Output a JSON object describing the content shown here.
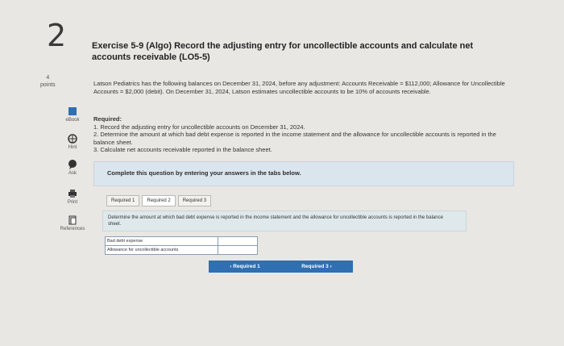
{
  "question": {
    "number": "2",
    "points_value": "4",
    "points_label": "points"
  },
  "sidebar": {
    "items": [
      {
        "label": "eBook"
      },
      {
        "label": "Hint"
      },
      {
        "label": "Ask"
      },
      {
        "label": "Print"
      },
      {
        "label": "References"
      }
    ]
  },
  "exercise": {
    "title": "Exercise 5-9 (Algo) Record the adjusting entry for uncollectible accounts and calculate net accounts receivable (LO5-5)",
    "intro": "Latson Pediatrics has the following balances on December 31, 2024, before any adjustment: Accounts Receivable = $112,000; Allowance for Uncollectible Accounts = $2,000 (debit). On December 31, 2024, Latson estimates uncollectible accounts to be 10% of accounts receivable.",
    "required_heading": "Required:",
    "required_items": [
      "1. Record the adjusting entry for uncollectible accounts on December 31, 2024.",
      "2. Determine the amount at which bad debt expense is reported in the income statement and the allowance for uncollectible accounts is reported in the balance sheet.",
      "3. Calculate net accounts receivable reported in the balance sheet."
    ]
  },
  "banner": {
    "text": "Complete this question by entering your answers in the tabs below."
  },
  "tabs": [
    {
      "label": "Required 1"
    },
    {
      "label": "Required 2"
    },
    {
      "label": "Required 3"
    }
  ],
  "instruction": {
    "text": "Determine the amount at which bad debt expense is reported in the income statement and the allowance for uncollectible accounts is reported in the balance sheet."
  },
  "form": {
    "rows": [
      {
        "label": "Bad debt expense",
        "value": ""
      },
      {
        "label": "Allowance for uncollectible accounts",
        "value": ""
      }
    ]
  },
  "nav": {
    "prev_label": "Required 1",
    "next_label": "Required 3"
  },
  "colors": {
    "accent": "#2f6fb2",
    "banner": "#dbe5ee",
    "background": "#e9e7e3"
  }
}
